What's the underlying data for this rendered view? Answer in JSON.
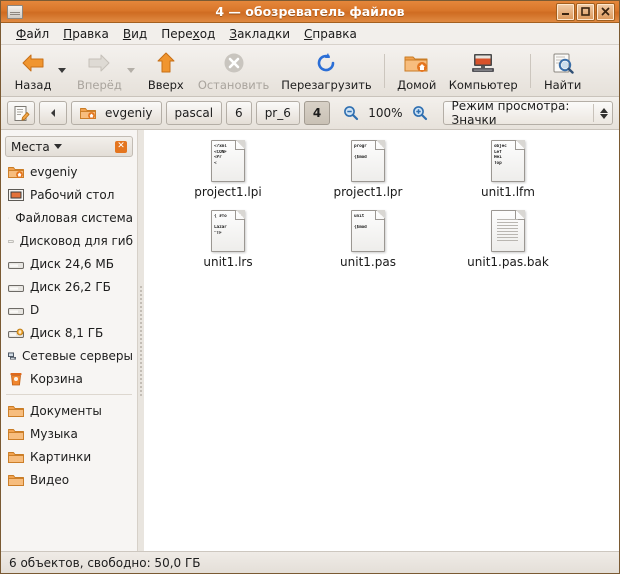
{
  "window": {
    "title": "4 — обозреватель файлов",
    "minimize_label": "_",
    "maximize_label": "□",
    "close_label": "✕"
  },
  "menubar": {
    "items": [
      {
        "label": "Файл",
        "accel": "Ф"
      },
      {
        "label": "Правка",
        "accel": "П"
      },
      {
        "label": "Вид",
        "accel": "В"
      },
      {
        "label": "Переход",
        "accel": "х"
      },
      {
        "label": "Закладки",
        "accel": "З"
      },
      {
        "label": "Справка",
        "accel": "С"
      }
    ]
  },
  "toolbar": {
    "back": "Назад",
    "forward": "Вперёд",
    "up": "Вверх",
    "stop": "Остановить",
    "reload": "Перезагрузить",
    "home": "Домой",
    "computer": "Компьютер",
    "find": "Найти"
  },
  "locationbar": {
    "edit_location_icon": "edit-location-icon",
    "scroll_left": "◂",
    "breadcrumbs": [
      {
        "label": "evgeniy",
        "icon": "home-folder-icon",
        "active": false
      },
      {
        "label": "pascal",
        "icon": "",
        "active": false
      },
      {
        "label": "6",
        "icon": "",
        "active": false
      },
      {
        "label": "pr_6",
        "icon": "",
        "active": false
      },
      {
        "label": "4",
        "icon": "",
        "active": true
      }
    ],
    "zoom_out": "zoom-out-icon",
    "zoom_level": "100%",
    "zoom_in": "zoom-in-icon",
    "view_mode": "Режим просмотра: Значки"
  },
  "sidebar": {
    "header": "Места",
    "close_label": "✕",
    "group1": [
      {
        "label": "evgeniy",
        "icon": "home-folder-icon"
      },
      {
        "label": "Рабочий стол",
        "icon": "desktop-icon"
      },
      {
        "label": "Файловая система",
        "icon": "drive-icon"
      },
      {
        "label": "Дисковод для гиб",
        "icon": "floppy-icon"
      },
      {
        "label": "Диск 24,6 МБ",
        "icon": "drive-icon"
      },
      {
        "label": "Диск 26,2 ГБ",
        "icon": "drive-icon"
      },
      {
        "label": "D",
        "icon": "drive-icon"
      },
      {
        "label": "Диск 8,1 ГБ",
        "icon": "usb-drive-icon"
      },
      {
        "label": "Сетевые серверы",
        "icon": "network-icon"
      },
      {
        "label": "Корзина",
        "icon": "trash-icon"
      }
    ],
    "group2": [
      {
        "label": "Документы",
        "icon": "folder-icon"
      },
      {
        "label": "Музыка",
        "icon": "folder-icon"
      },
      {
        "label": "Картинки",
        "icon": "folder-icon"
      },
      {
        "label": "Видео",
        "icon": "folder-icon"
      }
    ]
  },
  "files": [
    {
      "name": "project1.lpi",
      "icon": "text-document-icon",
      "preview": [
        "<?xml",
        "<CONF",
        "  <Pr",
        "    <"
      ]
    },
    {
      "name": "project1.lpr",
      "icon": "text-document-icon",
      "preview": [
        "progr",
        "",
        "{$mod"
      ]
    },
    {
      "name": "unit1.lfm",
      "icon": "text-document-icon",
      "preview": [
        "objec",
        "  Lef",
        "  Hei",
        "  Top"
      ]
    },
    {
      "name": "unit1.lrs",
      "icon": "text-document-icon",
      "preview": [
        "{ Это",
        "",
        "Lazar",
        "  \"TF"
      ]
    },
    {
      "name": "unit1.pas",
      "icon": "text-document-icon",
      "preview": [
        "unit",
        "",
        "{$mod"
      ]
    },
    {
      "name": "unit1.pas.bak",
      "icon": "plain-document-icon",
      "preview": []
    }
  ],
  "statusbar": {
    "text": "6 объектов, свободно: 50,0 ГБ"
  },
  "colors": {
    "titlebar": "#d9762a",
    "accent": "#e4751f",
    "window_bg": "#efebe7",
    "file_area": "#ffffff"
  }
}
